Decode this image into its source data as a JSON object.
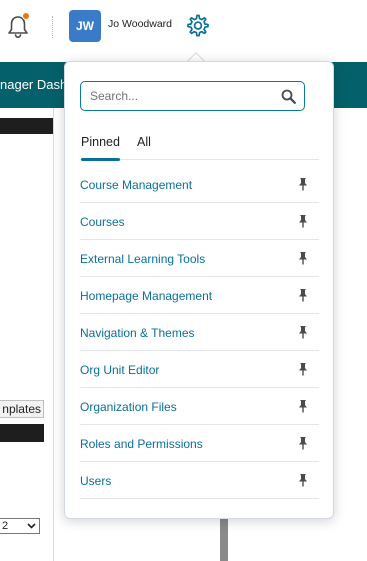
{
  "header": {
    "avatar_initials": "JW",
    "user_name": "Jo Woodward",
    "notification_dot_color": "#e87511",
    "icons": [
      "bell-icon",
      "gear-icon"
    ]
  },
  "background": {
    "nav_title": "nager Dash",
    "tab_label": "nplates",
    "select_value": "2"
  },
  "admin_menu": {
    "search_placeholder": "Search...",
    "tabs": [
      {
        "label": "Pinned",
        "active": true
      },
      {
        "label": "All",
        "active": false
      }
    ],
    "items": [
      {
        "label": "Course Management",
        "pinned": true
      },
      {
        "label": "Courses",
        "pinned": true
      },
      {
        "label": "External Learning Tools",
        "pinned": true
      },
      {
        "label": "Homepage Management",
        "pinned": true
      },
      {
        "label": "Navigation & Themes",
        "pinned": true
      },
      {
        "label": "Org Unit Editor",
        "pinned": true
      },
      {
        "label": "Organization Files",
        "pinned": true
      },
      {
        "label": "Roles and Permissions",
        "pinned": true
      },
      {
        "label": "Users",
        "pinned": true
      }
    ]
  },
  "colors": {
    "nav_band": "#04606a",
    "link": "#0a6f99",
    "accent": "#0a7a9a",
    "avatar_bg": "#3a7bc8"
  }
}
